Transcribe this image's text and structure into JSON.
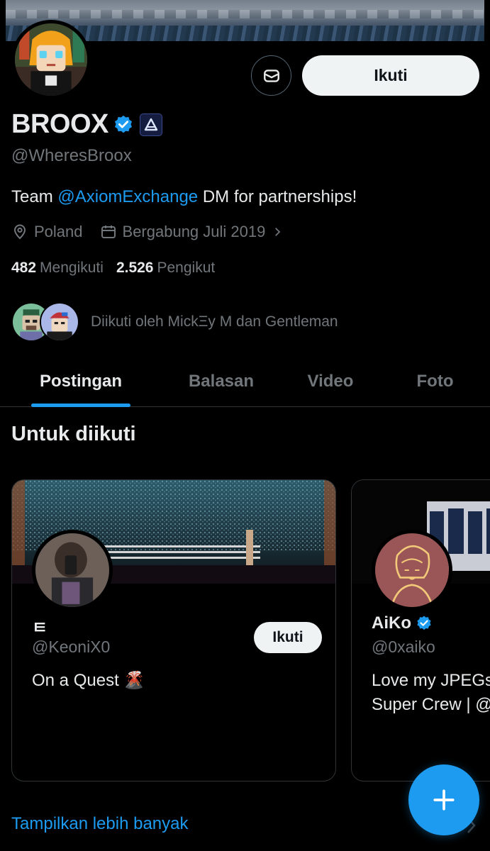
{
  "profile": {
    "name": "BROOX",
    "handle": "@WheresBroox",
    "bio_prefix": "Team ",
    "bio_mention": "@AxiomExchange",
    "bio_suffix": " DM for partnerships!",
    "location": "Poland",
    "joined": "Bergabung Juli 2019",
    "following_count": "482",
    "following_label": "Mengikuti",
    "followers_count": "2.526",
    "followers_label": "Pengikut",
    "followed_by": "Diikuti oleh MickΞy M dan Gentleman"
  },
  "actions": {
    "follow_label": "Ikuti",
    "message_icon": "envelope-icon"
  },
  "tabs": [
    {
      "label": "Postingan",
      "active": true
    },
    {
      "label": "Balasan",
      "active": false
    },
    {
      "label": "Video",
      "active": false
    },
    {
      "label": "Foto",
      "active": false
    }
  ],
  "suggestions": {
    "title": "Untuk diikuti",
    "cards": [
      {
        "name": "ㅌ",
        "handle": "@KeoniX0",
        "bio": "On a Quest 🌋",
        "follow_label": "Ikuti",
        "verified": false
      },
      {
        "name": "AiKo",
        "handle": "@0xaiko",
        "bio_line1": "Love my JPEGs",
        "bio_line2": "Super Crew | @",
        "verified": true
      }
    ],
    "show_more": "Tampilkan lebih banyak"
  },
  "colors": {
    "accent": "#1d9bf0",
    "background": "#000000",
    "text_primary": "#e7e9ea",
    "text_secondary": "#71767b"
  },
  "fab_icon": "plus-icon"
}
